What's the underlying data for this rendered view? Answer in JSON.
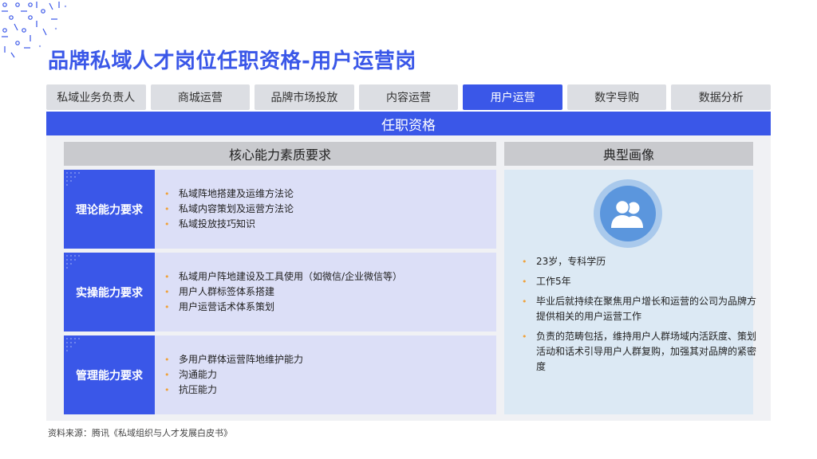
{
  "title": "品牌私域人才岗位任职资格-用户运营岗",
  "tabs": [
    {
      "label": "私域业务负责人",
      "active": false
    },
    {
      "label": "商城运营",
      "active": false
    },
    {
      "label": "品牌市场投放",
      "active": false
    },
    {
      "label": "内容运营",
      "active": false
    },
    {
      "label": "用户运营",
      "active": true
    },
    {
      "label": "数字导购",
      "active": false
    },
    {
      "label": "数据分析",
      "active": false
    }
  ],
  "banner": "任职资格",
  "headers": {
    "left": "核心能力素质要求",
    "right": "典型画像"
  },
  "rows": [
    {
      "label": "理论能力要求",
      "items": [
        "私域阵地搭建及运维方法论",
        "私域内容策划及运营方法论",
        "私域投放技巧知识"
      ]
    },
    {
      "label": "实操能力要求",
      "items": [
        "私域用户阵地建设及工具使用（如微信/企业微信等）",
        "用户人群标签体系搭建",
        "用户运营话术体系策划"
      ]
    },
    {
      "label": "管理能力要求",
      "items": [
        "多用户群体运营阵地维护能力",
        "沟通能力",
        "抗压能力"
      ]
    }
  ],
  "portrait": {
    "icon": "users-icon",
    "items": [
      "23岁，专科学历",
      "工作5年",
      "毕业后就持续在聚焦用户增长和运营的公司为品牌方提供相关的用户运营工作",
      "负责的范畴包括，维持用户人群场域内活跃度、策划活动和话术引导用户人群复购，加强其对品牌的紧密度"
    ]
  },
  "source": "资料来源：腾讯《私域组织与人才发展白皮书》",
  "colors": {
    "accent": "#3a57e8",
    "bullet": "#f0a23b",
    "row_body": "#dcdff7",
    "portrait_bg": "#dce9f4",
    "header_bg": "#c9cace"
  }
}
